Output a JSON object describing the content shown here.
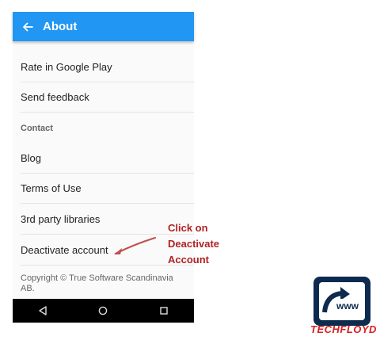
{
  "header": {
    "title": "About",
    "back_icon": "arrow-left-icon"
  },
  "menu": {
    "rate": "Rate in Google Play",
    "feedback": "Send feedback",
    "section_contact": "Contact",
    "blog": "Blog",
    "terms": "Terms of Use",
    "libraries": "3rd party libraries",
    "deactivate": "Deactivate account"
  },
  "footer": {
    "copyright": "Copyright © True Software Scandinavia AB."
  },
  "navbar": {
    "icons": [
      "back-triangle-icon",
      "home-circle-icon",
      "recents-square-icon"
    ]
  },
  "annotation": {
    "line1": "Click on",
    "line2": "Deactivate",
    "line3": "Account"
  },
  "logo": {
    "www_text": "www",
    "brand_text": "TECHFLOYD"
  },
  "colors": {
    "appbar": "#2196f3",
    "annotation": "#b22222",
    "brand": "#d42020",
    "logo_dark": "#0d2b4e"
  }
}
